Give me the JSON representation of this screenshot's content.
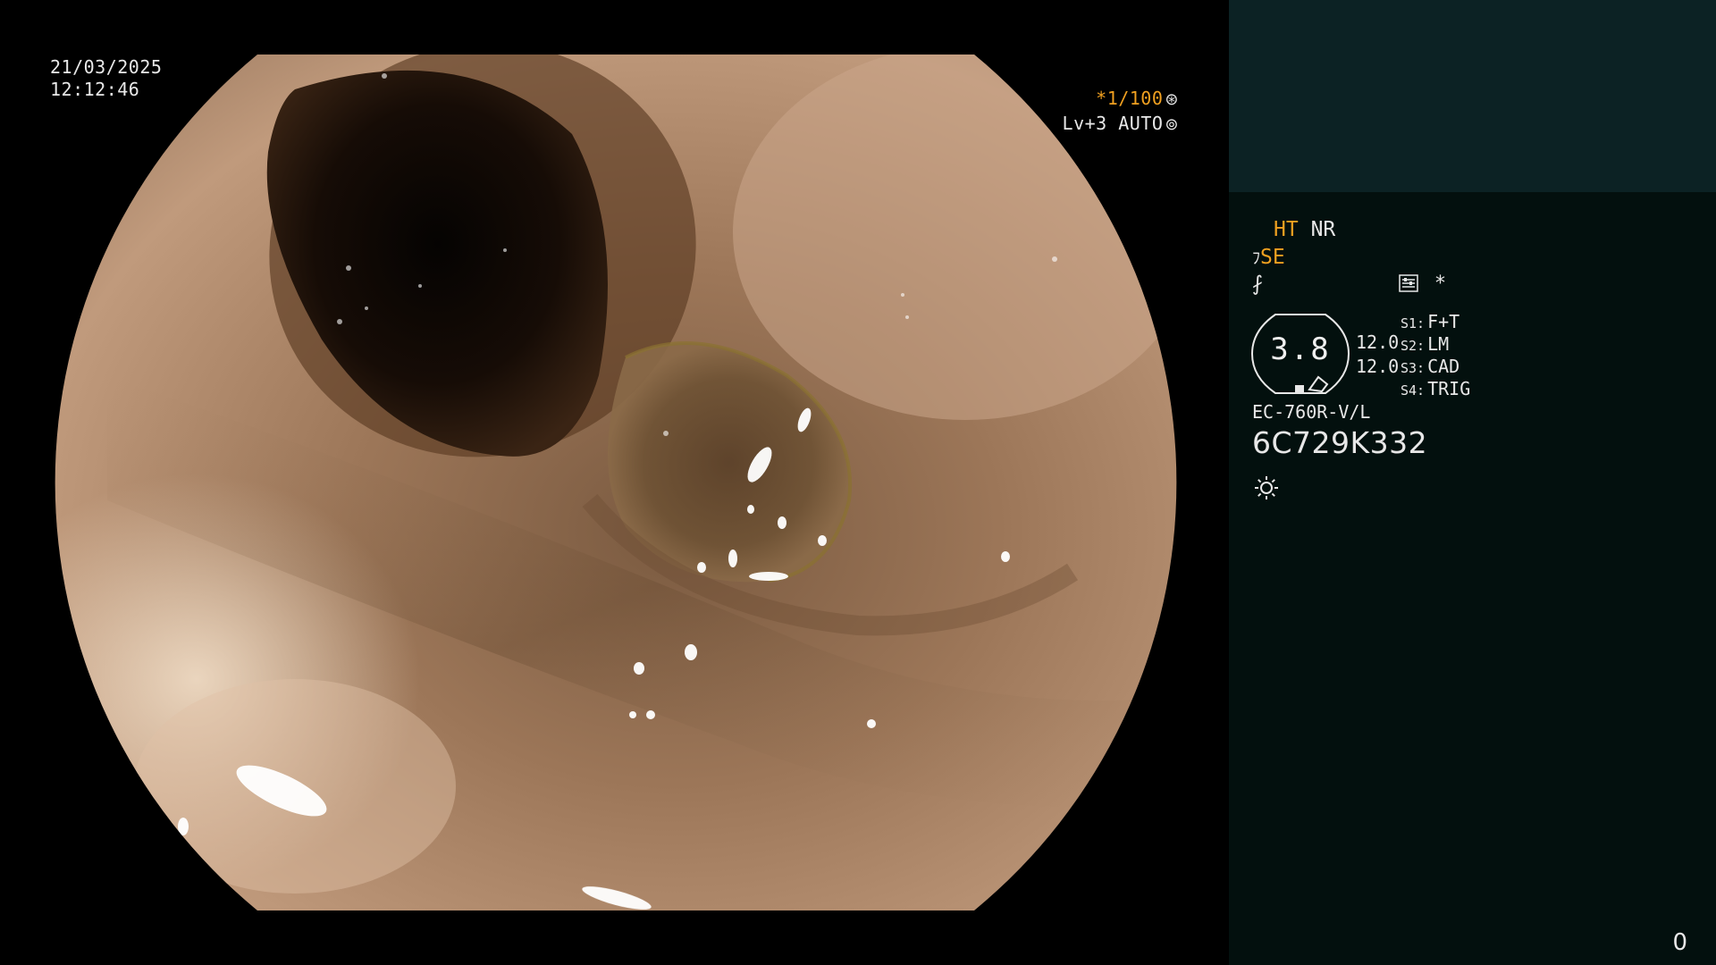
{
  "osd": {
    "date": "21/03/2025",
    "time": "12:12:46",
    "shutter_prefix": "*",
    "shutter_value": "1/100",
    "shutter_icon": "shutter-icon",
    "level_label": "Lv+3 AUTO",
    "level_icon": "iris-icon"
  },
  "panel": {
    "ht": "HT",
    "nr": "NR",
    "se_prefix": "ﾌ",
    "se": "SE",
    "enhance_symbol": "⨏",
    "settings_icon": "settings-panel-icon",
    "asterisk": "*",
    "zoom_value": "3.8",
    "value_a": "12.0",
    "value_b": "12.0",
    "slots": [
      {
        "key": "S1:",
        "value": "F+T"
      },
      {
        "key": "S2:",
        "value": "LM"
      },
      {
        "key": "S3:",
        "value": "CAD"
      },
      {
        "key": "S4:",
        "value": "TRIG"
      }
    ],
    "model": "EC-760R-V/L",
    "serial": "6C729K332",
    "light_icon": "light-source-icon",
    "counter": "0"
  },
  "colors": {
    "accent_orange": "#f0a020",
    "panel_bg": "#03100e",
    "panel_top_bg": "#0c2224",
    "text": "#e8e8e8"
  }
}
